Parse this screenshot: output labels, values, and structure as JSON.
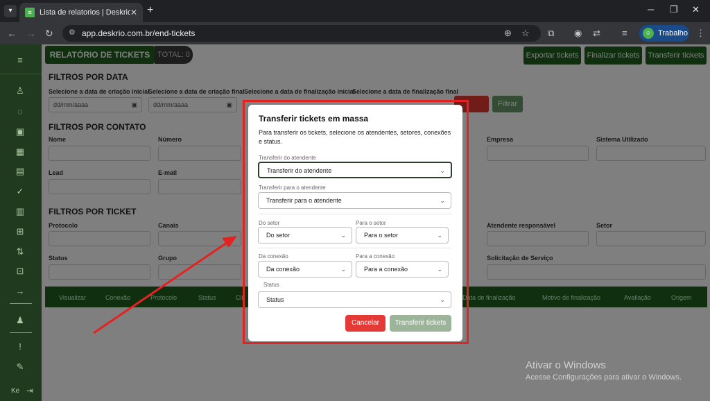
{
  "browser": {
    "tab_title": "Lista de relatorios | Deskrio",
    "url": "app.deskrio.com.br/end-tickets",
    "profile_label": "Trabalho"
  },
  "page": {
    "header_title": "RELATÓRIO DE TICKETS",
    "total_label": "TOTAL: 0",
    "actions": [
      "Exportar tickets",
      "Finalizar tickets",
      "Transferir tickets"
    ],
    "filtros_data": {
      "title": "FILTROS POR DATA",
      "labels": [
        "Selecione a data de criação inicial",
        "Selecione a data de criação final",
        "Selecione a data de finalização inicial",
        "Selecione a data de finalização final"
      ],
      "placeholder": "dd/mm/aaaa",
      "filter_button": "Filtrar"
    },
    "filtros_contato": {
      "title": "FILTROS POR CONTATO",
      "row1_left": [
        "Nome",
        "Número"
      ],
      "row1_right": [
        "Empresa",
        "Sistema Utilizado"
      ],
      "row2_left": [
        "Lead",
        "E-mail"
      ]
    },
    "filtros_ticket": {
      "title": "FILTROS POR TICKET",
      "row1_left": [
        "Protocolo",
        "Canais"
      ],
      "row1_right": [
        "Atendente responsável",
        "Setor"
      ],
      "row2_left": [
        "Status",
        "Grupo"
      ],
      "row2_right": [
        "Solicitação de Serviço"
      ]
    },
    "table_headers_left": [
      "Visualizar",
      "Conexão",
      "Protocolo",
      "Status",
      "Cli"
    ],
    "table_headers_right": [
      "Data de finalização",
      "Motivo de finalização",
      "Avaliação",
      "Origem"
    ]
  },
  "modal": {
    "title": "Transferir tickets em massa",
    "description": "Para transferir os tickets, selecione os atendentes, setores, conexões e status.",
    "from_agent_label": "Transferir do atendente",
    "from_agent_value": "Transferir do atendente",
    "to_agent_label": "Transferir para o atendente",
    "to_agent_value": "Transferir para o atendente",
    "from_sector_label": "Do setor",
    "from_sector_value": "Do setor",
    "to_sector_label": "Para o setor",
    "to_sector_value": "Para o setor",
    "from_connection_label": "Da conexão",
    "from_connection_value": "Da conexão",
    "to_connection_label": "Para a conexão",
    "to_connection_value": "Para a conexão",
    "status_label": "Status",
    "status_value": "Status",
    "cancel_button": "Cancelar",
    "transfer_button": "Transferir tickets"
  },
  "sidebar_footer": "Ke",
  "windows_watermark": {
    "title": "Ativar o Windows",
    "subtitle": "Acesse Configurações para ativar o Windows."
  },
  "colors": {
    "primary_green": "#1e5f1c",
    "danger_red": "#e53935",
    "annotation_red": "#e52222",
    "disabled_green": "#9cb59a"
  }
}
